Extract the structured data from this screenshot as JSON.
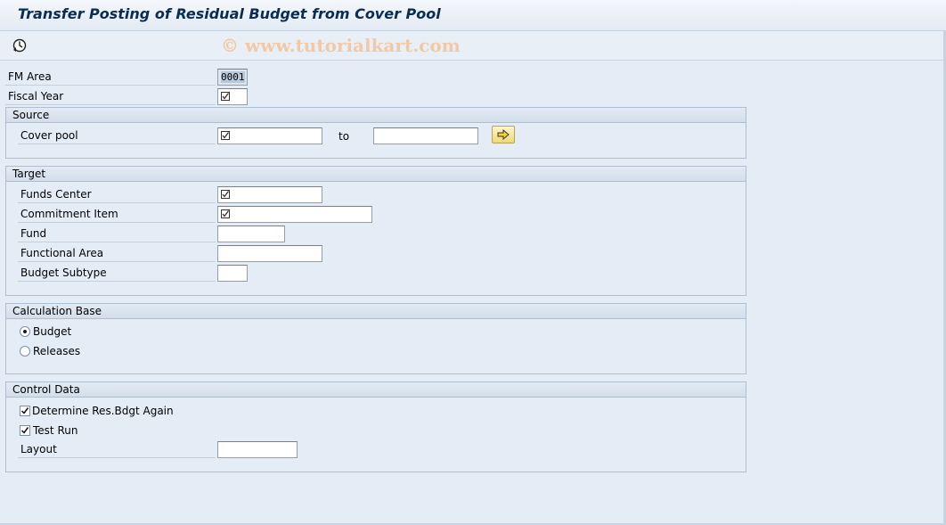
{
  "title": "Transfer Posting of Residual Budget from Cover Pool",
  "toolbar": {
    "execute_icon": "execute-clock-icon"
  },
  "watermark": "© www.tutorialkart.com",
  "header_fields": {
    "fm_area": {
      "label": "FM Area",
      "value": "0001"
    },
    "fiscal_year": {
      "label": "Fiscal Year",
      "value": ""
    }
  },
  "source": {
    "title": "Source",
    "cover_pool": {
      "label": "Cover pool",
      "from": "",
      "to_label": "to",
      "to": ""
    },
    "multiple_selection_icon": "arrow-right-icon"
  },
  "target": {
    "title": "Target",
    "funds_center": {
      "label": "Funds Center",
      "value": ""
    },
    "commitment_item": {
      "label": "Commitment Item",
      "value": ""
    },
    "fund": {
      "label": "Fund",
      "value": ""
    },
    "functional_area": {
      "label": "Functional Area",
      "value": ""
    },
    "budget_subtype": {
      "label": "Budget Subtype",
      "value": ""
    }
  },
  "calculation_base": {
    "title": "Calculation Base",
    "options": [
      {
        "label": "Budget",
        "selected": true
      },
      {
        "label": "Releases",
        "selected": false
      }
    ]
  },
  "control_data": {
    "title": "Control Data",
    "determine_res_bdgt_again": {
      "label": "Determine Res.Bdgt Again",
      "checked": true
    },
    "test_run": {
      "label": "Test Run",
      "checked": true
    },
    "layout": {
      "label": "Layout",
      "value": ""
    }
  }
}
